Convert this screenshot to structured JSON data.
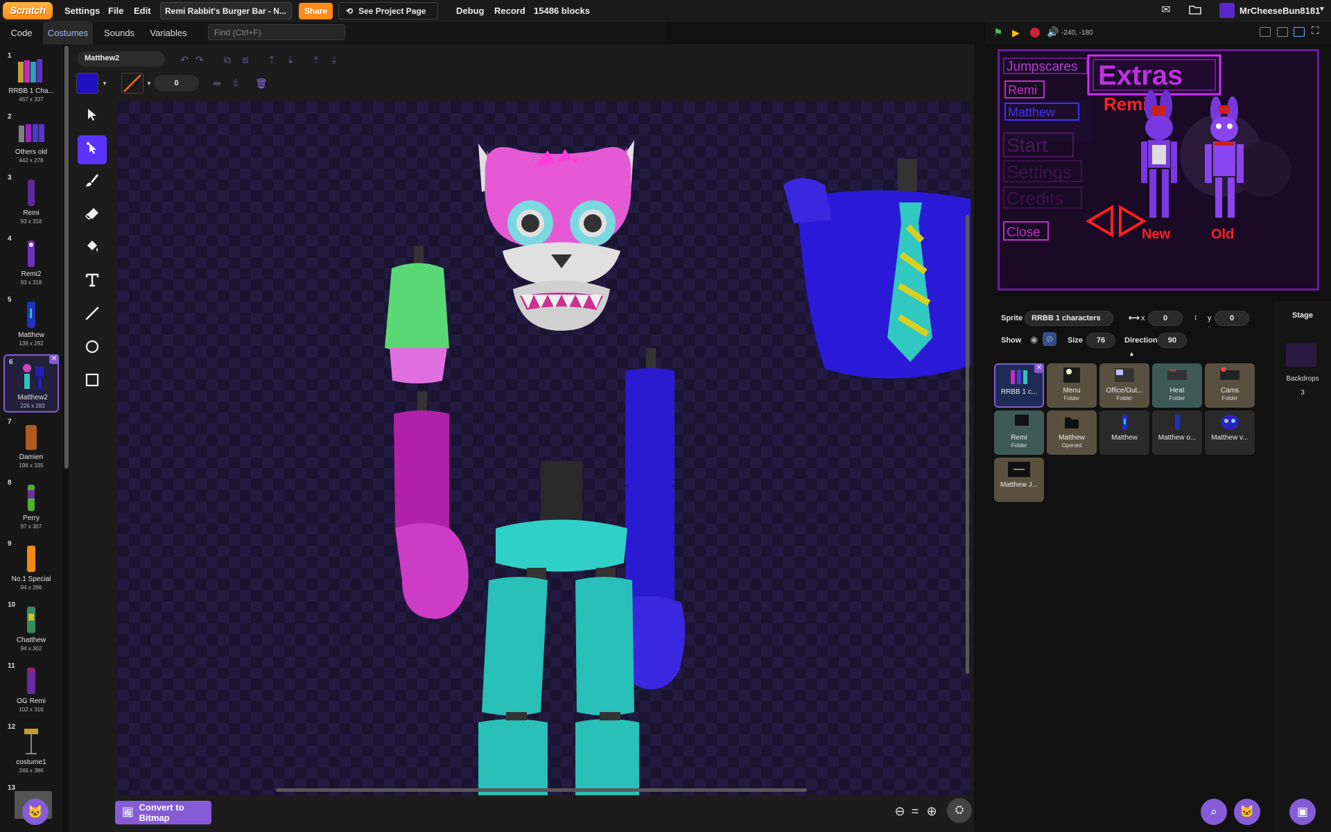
{
  "menubar": {
    "logo": "Scratch",
    "settings": "Settings",
    "file": "File",
    "edit": "Edit",
    "project_title": "Remi Rabbit's Burger Bar - N...",
    "share": "Share",
    "see_project": "See Project Page",
    "debug": "Debug",
    "record": "Record",
    "blocks_count": "15486 blocks",
    "username": "MrCheeseBun8181"
  },
  "tabs": {
    "code": "Code",
    "costumes": "Costumes",
    "sounds": "Sounds",
    "variables": "Variables",
    "find_placeholder": "Find (Ctrl+F)"
  },
  "costumes": [
    {
      "num": "1",
      "name": "RRBB 1 Cha...",
      "size": "467 x 337"
    },
    {
      "num": "2",
      "name": "Others old",
      "size": "442 x 278"
    },
    {
      "num": "3",
      "name": "Remi",
      "size": "93 x 318"
    },
    {
      "num": "4",
      "name": "Remi2",
      "size": "93 x 318"
    },
    {
      "num": "5",
      "name": "Matthew",
      "size": "139 x 292"
    },
    {
      "num": "6",
      "name": "Matthew2",
      "size": "226 x 283"
    },
    {
      "num": "7",
      "name": "Damien",
      "size": "196 x 335"
    },
    {
      "num": "8",
      "name": "Perry",
      "size": "97 x 307"
    },
    {
      "num": "9",
      "name": "No.1 Special",
      "size": "94 x 286"
    },
    {
      "num": "10",
      "name": "Chatthew",
      "size": "94 x 302"
    },
    {
      "num": "11",
      "name": "OG Remi",
      "size": "102 x 316"
    },
    {
      "num": "12",
      "name": "costume1",
      "size": "246 x 386"
    },
    {
      "num": "13",
      "name": "",
      "size": ""
    }
  ],
  "paint": {
    "costume_name": "Matthew2",
    "stroke_width": "0",
    "fill_color": "#2010c0",
    "convert_label": "Convert to Bitmap"
  },
  "stage": {
    "coords": "-240, -180",
    "screen": {
      "jumpscares": "Jumpscares",
      "extras": "Extras",
      "remi_btn": "Remi",
      "matthew_btn": "Matthew",
      "start": "Start",
      "settings": "Settings",
      "credits": "Credits",
      "close": "Close",
      "remi_title": "Remi",
      "new_label": "New",
      "old_label": "Old"
    }
  },
  "sprite_info": {
    "sprite_label": "Sprite",
    "sprite_name": "RRBB 1 characters",
    "x_label": "x",
    "x_value": "0",
    "y_label": "y",
    "y_value": "0",
    "show_label": "Show",
    "size_label": "Size",
    "size_value": "76",
    "direction_label": "Direction",
    "direction_value": "90"
  },
  "sprites": [
    {
      "name": "RRBB 1 c...",
      "sub": ""
    },
    {
      "name": "Menu",
      "sub": "Folder"
    },
    {
      "name": "Office/Out...",
      "sub": "Folder"
    },
    {
      "name": "Heat",
      "sub": "Folder"
    },
    {
      "name": "Cams",
      "sub": "Folder"
    },
    {
      "name": "Remi",
      "sub": "Folder"
    },
    {
      "name": "Matthew",
      "sub": "Opened"
    },
    {
      "name": "Matthew",
      "sub": ""
    },
    {
      "name": "Matthew o...",
      "sub": ""
    },
    {
      "name": "Matthew v...",
      "sub": ""
    },
    {
      "name": "Matthew J...",
      "sub": ""
    }
  ],
  "stage_pane": {
    "title": "Stage",
    "backdrops_label": "Backdrops",
    "backdrops_count": "3"
  },
  "colors": {
    "accent": "#855cd6",
    "share": "#ff8c1a",
    "tool_active": "#5b33ff"
  }
}
